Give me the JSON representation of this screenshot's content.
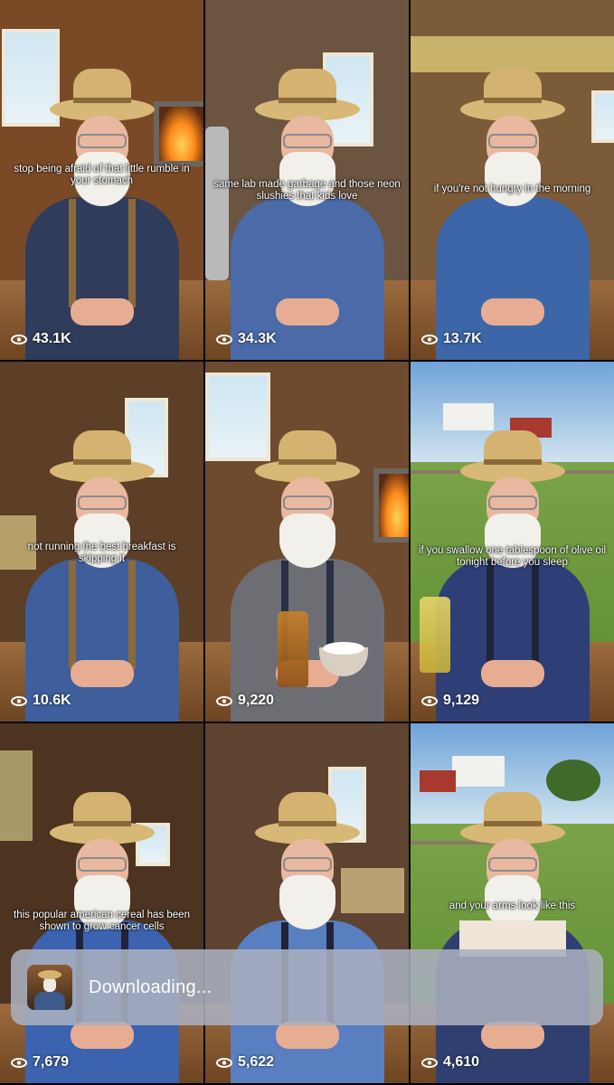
{
  "videos": [
    {
      "caption": "stop being afraid of that little rumble in your stomach",
      "views": "43.1K",
      "scene": "cabin-fireplace",
      "shirt_color": "#2f3c5c",
      "suspenders": true
    },
    {
      "caption": "same lab made garbage and those neon slushies that kids love",
      "views": "34.3K",
      "scene": "barn-window",
      "shirt_color": "#4a6aa8",
      "suspenders": false
    },
    {
      "caption": "if you're not hungry in the morning",
      "views": "13.7K",
      "scene": "barn-hay",
      "shirt_color": "#3c66a8",
      "suspenders": false
    },
    {
      "caption": "not running the best breakfast is skipping it",
      "views": "10.6K",
      "scene": "barn-dark",
      "shirt_color": "#3e5f9c",
      "suspenders": true
    },
    {
      "caption": "",
      "views": "9,220",
      "scene": "cabin-fireplace-2",
      "shirt_color": "#6d6e73",
      "suspenders": true
    },
    {
      "caption": "if you swallow one tablespoon of olive oil tonight before you sleep",
      "views": "9,129",
      "scene": "farm-field",
      "shirt_color": "#2e3f77",
      "suspenders": true
    },
    {
      "caption": "this popular american cereal has been shown to grow cancer cells",
      "views": "7,679",
      "scene": "barn-dark-2",
      "shirt_color": "#3c63b0",
      "suspenders": true
    },
    {
      "caption": "",
      "views": "5,622",
      "scene": "barn-window-2",
      "shirt_color": "#5a7fc0",
      "suspenders": true
    },
    {
      "caption": "and your arms look like this",
      "views": "4,610",
      "scene": "farm-field-2",
      "shirt_color": "#2f3f70",
      "suspenders": false
    }
  ],
  "toast": {
    "text": "Downloading...",
    "thumbnail_icon": "video-thumbnail"
  },
  "colors": {
    "toast_bg": "rgba(170,175,190,0.88)",
    "text": "#ffffff"
  }
}
